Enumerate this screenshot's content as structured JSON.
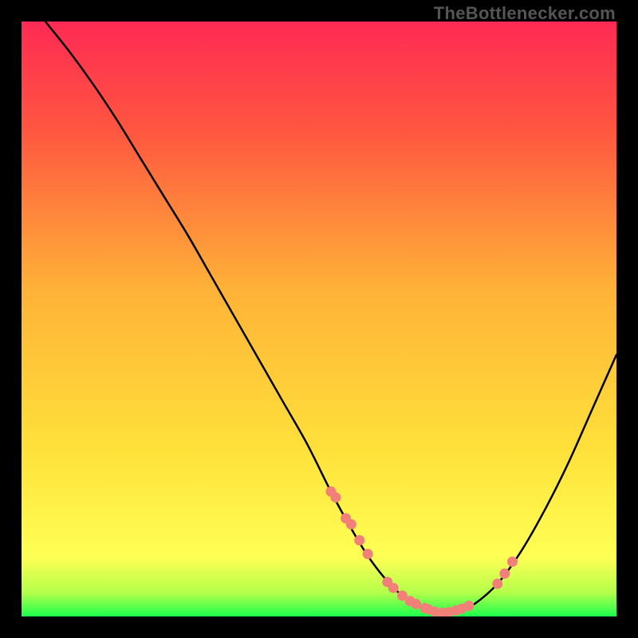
{
  "watermark": "TheBottlenecker.com",
  "chart_data": {
    "type": "line",
    "title": "",
    "xlabel": "",
    "ylabel": "",
    "xlim": [
      0,
      100
    ],
    "ylim": [
      0,
      100
    ],
    "background_gradient": {
      "top_color": "#ff2a55",
      "mid_color": "#ffe13a",
      "bottom_color": "#1bff4d"
    },
    "series": [
      {
        "name": "curve",
        "type": "line",
        "color": "#000000",
        "x": [
          4,
          8,
          12,
          16,
          20,
          24,
          28,
          32,
          36,
          40,
          44,
          48,
          52,
          55,
          58,
          61,
          64,
          67,
          70,
          73,
          76,
          80,
          84,
          88,
          92,
          96,
          100
        ],
        "y": [
          100,
          95,
          89.5,
          83.5,
          77,
          70.5,
          64,
          57,
          50,
          43,
          36,
          29,
          21,
          15.5,
          10.5,
          6.5,
          3.5,
          1.6,
          0.6,
          0.6,
          2.0,
          5.5,
          11,
          18,
          26,
          35,
          44
        ]
      },
      {
        "name": "markers",
        "type": "scatter",
        "color": "#f08078",
        "x": [
          52.0,
          52.8,
          54.5,
          55.4,
          56.8,
          58.2,
          61.5,
          62.5,
          64.0,
          65.3,
          66.3,
          67.8,
          68.4,
          69.5,
          70.8,
          71.8,
          73.0,
          74.0,
          75.2,
          80.0,
          81.2,
          82.5
        ],
        "y": [
          21.0,
          20.0,
          16.5,
          15.5,
          12.8,
          10.5,
          5.8,
          4.8,
          3.5,
          2.6,
          2.1,
          1.4,
          1.2,
          0.8,
          0.6,
          0.7,
          1.0,
          1.3,
          1.8,
          5.5,
          7.2,
          9.2
        ]
      }
    ]
  }
}
